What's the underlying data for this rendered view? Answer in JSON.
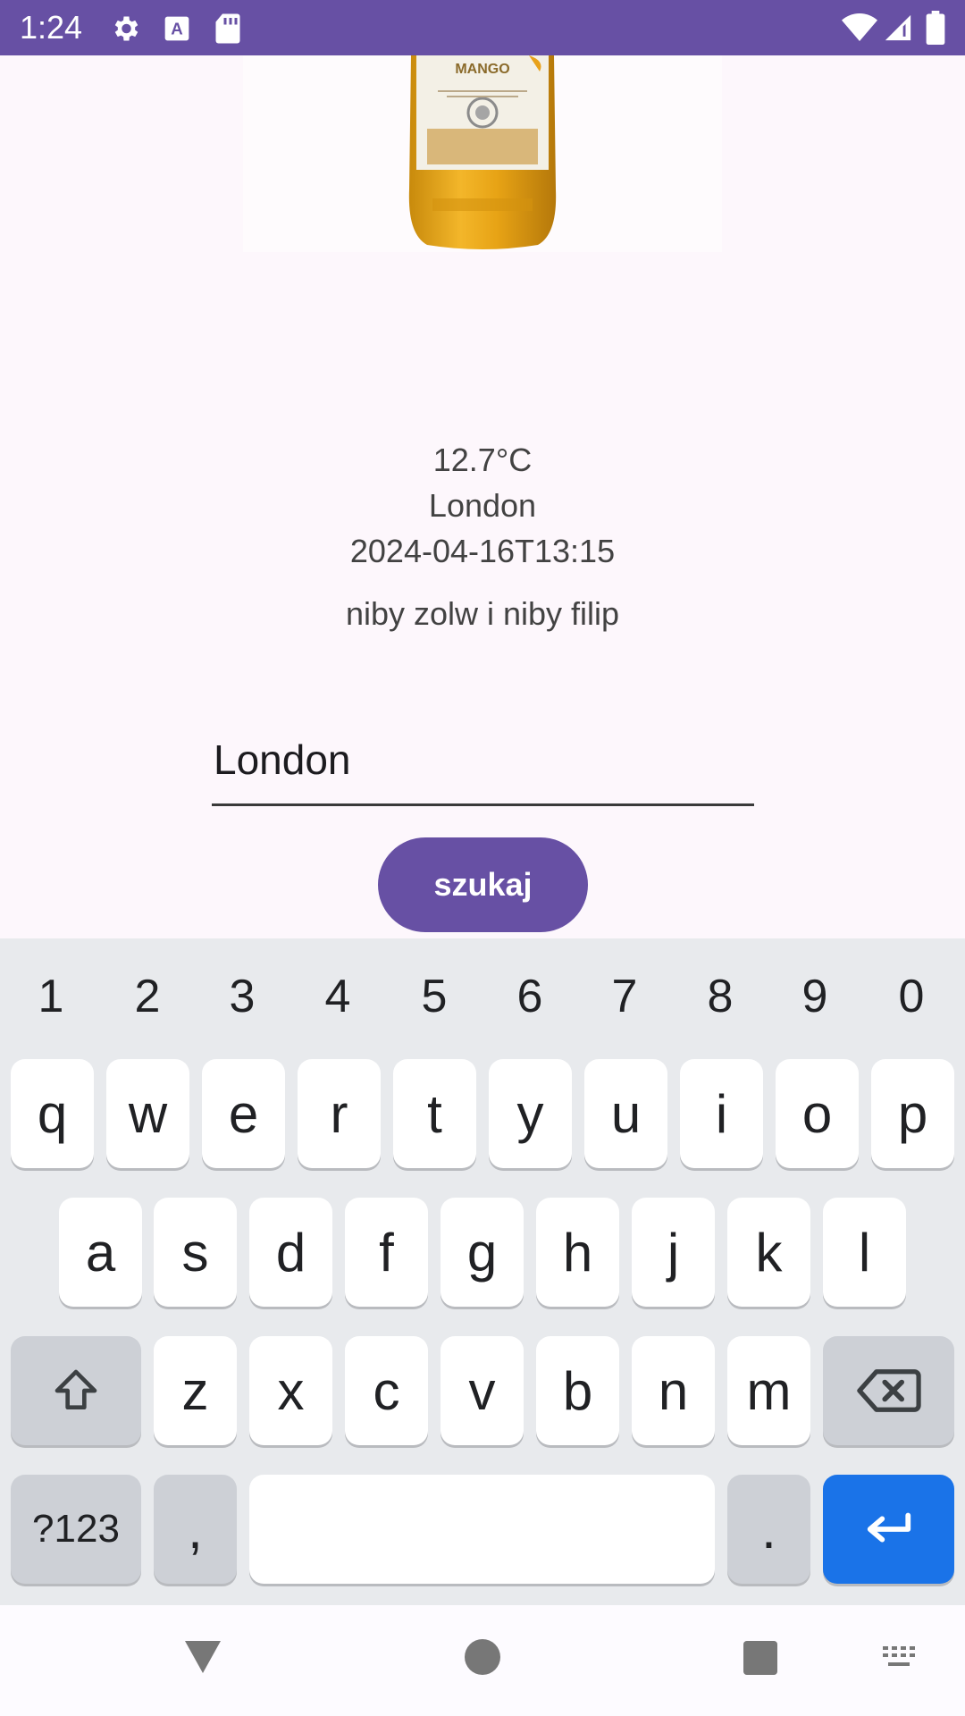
{
  "status_bar": {
    "time": "1:24"
  },
  "weather": {
    "temperature": "12.7°C",
    "city": "London",
    "datetime": "2024-04-16T13:15"
  },
  "subtitle": "niby zolw i niby filip",
  "product_label": "MANGO",
  "search": {
    "value": "London",
    "button_label": "szukaj"
  },
  "keyboard": {
    "numbers": [
      "1",
      "2",
      "3",
      "4",
      "5",
      "6",
      "7",
      "8",
      "9",
      "0"
    ],
    "row1": [
      "q",
      "w",
      "e",
      "r",
      "t",
      "y",
      "u",
      "i",
      "o",
      "p"
    ],
    "row2": [
      "a",
      "s",
      "d",
      "f",
      "g",
      "h",
      "j",
      "k",
      "l"
    ],
    "row3": [
      "z",
      "x",
      "c",
      "v",
      "b",
      "n",
      "m"
    ],
    "symbols_label": "?123",
    "comma": ",",
    "period": "."
  },
  "colors": {
    "primary": "#6750a4",
    "background": "#fdf7fc",
    "enter_key": "#1a73e8"
  }
}
